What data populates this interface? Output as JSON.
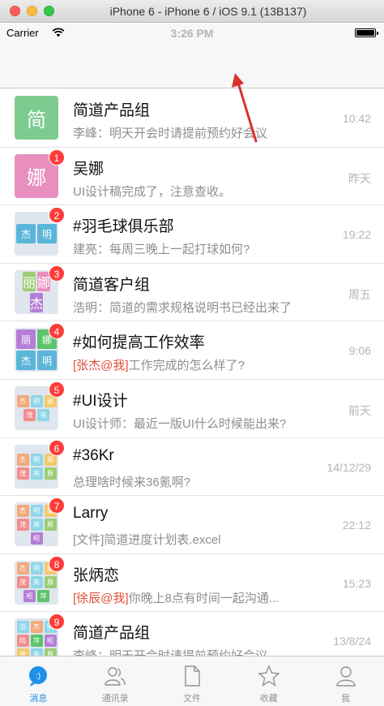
{
  "window": {
    "title": "iPhone 6 - iPhone 6 / iOS 9.1 (13B137)"
  },
  "status_bar": {
    "carrier": "Carrier",
    "time": "3:26 PM"
  },
  "colors": {
    "accent": "#1e90e8",
    "badge": "#fc3d39",
    "mention": "#e0503c",
    "annotation_arrow": "#d9332a"
  },
  "chats": [
    {
      "title": "简道产品组",
      "preview": "李峰：明天开会时请提前预约好会议",
      "time": "10:42",
      "badge": "",
      "avatar": {
        "type": "single",
        "letter": "简",
        "color": "#7ecb8f"
      }
    },
    {
      "title": "吴娜",
      "preview": "UI设计稿完成了，注意查收。",
      "time": "昨天",
      "badge": "1",
      "avatar": {
        "type": "single",
        "letter": "娜",
        "color": "#e98fbf"
      }
    },
    {
      "title": "#羽毛球俱乐部",
      "preview": "建亮：每周三晚上一起打球如何?",
      "time": "19:22",
      "badge": "2",
      "avatar": {
        "type": "grid",
        "cells": [
          {
            "t": "杰",
            "c": "#5bb5d9"
          },
          {
            "t": "明",
            "c": "#5bb5d9"
          }
        ]
      }
    },
    {
      "title": "简道客户组",
      "preview": "浩明：简道的需求规格说明书已经出来了",
      "time": "周五",
      "badge": "3",
      "avatar": {
        "type": "grid",
        "cells": [
          {
            "t": "丽",
            "c": "#9ccc73"
          },
          {
            "t": "娜",
            "c": "#e98fbf"
          },
          {
            "t": "杰",
            "c": "#b47ed6"
          }
        ]
      }
    },
    {
      "title": "#如何提高工作效率",
      "mention": "[张杰@我]",
      "preview": "工作完成的怎么样了?",
      "time": "9:06",
      "badge": "4",
      "avatar": {
        "type": "grid",
        "cells": [
          {
            "t": "丽",
            "c": "#b47ed6"
          },
          {
            "t": "娜",
            "c": "#5cc46c"
          },
          {
            "t": "杰",
            "c": "#5bb5d9"
          },
          {
            "t": "明",
            "c": "#5bb5d9"
          }
        ]
      }
    },
    {
      "title": "#UI设计",
      "preview": "UI设计师：最近一版UI什么时候能出来?",
      "time": "前天",
      "badge": "5",
      "avatar": {
        "type": "grid",
        "cells": [
          {
            "t": "杰",
            "c": "#f2a97c"
          },
          {
            "t": "明",
            "c": "#8fd6e8"
          },
          {
            "t": "丽",
            "c": "#f5c76a"
          },
          {
            "t": "茂",
            "c": "#f28d8d"
          },
          {
            "t": "亮",
            "c": "#8fd6e8"
          }
        ]
      }
    },
    {
      "title": "#36Kr",
      "preview": "总理啥时候来36氪啊?",
      "time": "14/12/29",
      "badge": "6",
      "avatar": {
        "type": "grid",
        "cells": [
          {
            "t": "杰",
            "c": "#f2a97c"
          },
          {
            "t": "明",
            "c": "#8fd6e8"
          },
          {
            "t": "丽",
            "c": "#f5c76a"
          },
          {
            "t": "茂",
            "c": "#f28d8d"
          },
          {
            "t": "亮",
            "c": "#8fd6e8"
          },
          {
            "t": "辰",
            "c": "#9ccc73"
          }
        ]
      }
    },
    {
      "title": "Larry",
      "preview": "[文件]简道进度计划表.excel",
      "time": "22:12",
      "badge": "7",
      "avatar": {
        "type": "grid",
        "cells": [
          {
            "t": "杰",
            "c": "#f2a97c"
          },
          {
            "t": "明",
            "c": "#8fd6e8"
          },
          {
            "t": "丽",
            "c": "#f5c76a"
          },
          {
            "t": "茂",
            "c": "#f28d8d"
          },
          {
            "t": "亮",
            "c": "#8fd6e8"
          },
          {
            "t": "辰",
            "c": "#9ccc73"
          },
          {
            "t": "昭",
            "c": "#b47ed6"
          }
        ]
      }
    },
    {
      "title": "张炳恋",
      "mention": "[徐辰@我]",
      "preview": "你晚上8点有时间一起沟通...",
      "time": "15:23",
      "badge": "8",
      "avatar": {
        "type": "grid",
        "cells": [
          {
            "t": "杰",
            "c": "#f2a97c"
          },
          {
            "t": "明",
            "c": "#8fd6e8"
          },
          {
            "t": "丽",
            "c": "#f5c76a"
          },
          {
            "t": "茂",
            "c": "#f28d8d"
          },
          {
            "t": "亮",
            "c": "#8fd6e8"
          },
          {
            "t": "辰",
            "c": "#9ccc73"
          },
          {
            "t": "昭",
            "c": "#b47ed6"
          },
          {
            "t": "萍",
            "c": "#5cc46c"
          }
        ]
      }
    },
    {
      "title": "简道产品组",
      "preview": "李峰：明天开会时请提前预约好会议",
      "time": "13/8/24",
      "badge": "9",
      "avatar": {
        "type": "grid",
        "cells": [
          {
            "t": "滔",
            "c": "#8fd6e8"
          },
          {
            "t": "杰",
            "c": "#f2a97c"
          },
          {
            "t": "明",
            "c": "#8fd6e8"
          },
          {
            "t": "陆",
            "c": "#f28d8d"
          },
          {
            "t": "萍",
            "c": "#5cc46c"
          },
          {
            "t": "昭",
            "c": "#b47ed6"
          },
          {
            "t": "茂",
            "c": "#f5c76a"
          },
          {
            "t": "亮",
            "c": "#8fd6e8"
          },
          {
            "t": "辰",
            "c": "#9ccc73"
          }
        ]
      }
    }
  ],
  "tabs": [
    {
      "label": "消息",
      "icon": "chat-bubble-icon",
      "active": true
    },
    {
      "label": "通讯录",
      "icon": "contacts-icon",
      "active": false
    },
    {
      "label": "文件",
      "icon": "document-icon",
      "active": false
    },
    {
      "label": "收藏",
      "icon": "star-icon",
      "active": false
    },
    {
      "label": "我",
      "icon": "person-icon",
      "active": false
    }
  ]
}
